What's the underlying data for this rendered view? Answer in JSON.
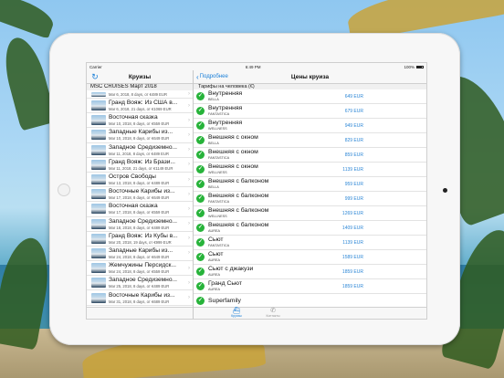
{
  "statusbar": {
    "carrier": "Carrier",
    "time": "6:49 PM",
    "battery": "100%"
  },
  "master": {
    "title": "Круизы",
    "section": "MSC CRUISES Март 2018",
    "cruises": [
      {
        "name": "",
        "meta": "Mar 6, 2018, 8 days, от €489 EUR"
      },
      {
        "name": "Гранд Вояж: Из США в...",
        "meta": "Mar 6, 2018, 21 days, от €1069 EUR"
      },
      {
        "name": "Восточная сказка",
        "meta": "Mar 10, 2018, 8 days, от €559 EUR"
      },
      {
        "name": "Западные Карибы из...",
        "meta": "Mar 10, 2018, 8 days, от €649 EUR"
      },
      {
        "name": "Западное Средиземно...",
        "meta": "Mar 11, 2018, 8 days, от €489 EUR"
      },
      {
        "name": "Гранд Вояж: Из Брази...",
        "meta": "Mar 11, 2018, 21 days, от €1149 EUR"
      },
      {
        "name": "Остров Свободы",
        "meta": "Mar 13, 2018, 8 days, от €489 EUR"
      },
      {
        "name": "Восточные Карибы из...",
        "meta": "Mar 17, 2018, 8 days, от €649 EUR"
      },
      {
        "name": "Восточная сказка",
        "meta": "Mar 17, 2018, 8 days, от €559 EUR"
      },
      {
        "name": "Западное Средиземно...",
        "meta": "Mar 18, 2018, 8 days, от €489 EUR"
      },
      {
        "name": "Гранд Вояж: Из Кубы в...",
        "meta": "Mar 20, 2018, 19 days, от €999 EUR"
      },
      {
        "name": "Западные Карибы из...",
        "meta": "Mar 24, 2018, 8 days, от €649 EUR"
      },
      {
        "name": "Жемчужины Персидск...",
        "meta": "Mar 24, 2018, 8 days, от €559 EUR"
      },
      {
        "name": "Западное Средиземно...",
        "meta": "Mar 25, 2018, 8 days, от €489 EUR"
      },
      {
        "name": "Восточные Карибы из...",
        "meta": "Mar 31, 2018, 8 days, от €689 EUR"
      }
    ]
  },
  "detail": {
    "back_label": "Подробнее",
    "title": "Цены круиза",
    "section": "Тарифы на человека (€)",
    "fares": [
      {
        "cabin": "Внутренняя",
        "ship": "BELLA",
        "price": "649 EUR"
      },
      {
        "cabin": "Внутренняя",
        "ship": "FANTASTICA",
        "price": "679 EUR"
      },
      {
        "cabin": "Внутренняя",
        "ship": "WELLNESS",
        "price": "949 EUR"
      },
      {
        "cabin": "Внешняя с окном",
        "ship": "BELLA",
        "price": "829 EUR"
      },
      {
        "cabin": "Внешняя с окном",
        "ship": "FANTASTICA",
        "price": "859 EUR"
      },
      {
        "cabin": "Внешняя с окном",
        "ship": "WELLNESS",
        "price": "1139 EUR"
      },
      {
        "cabin": "Внешняя с балконом",
        "ship": "BELLA",
        "price": "959 EUR"
      },
      {
        "cabin": "Внешняя с балконом",
        "ship": "FANTASTICA",
        "price": "999 EUR"
      },
      {
        "cabin": "Внешняя с балконом",
        "ship": "WELLNESS",
        "price": "1269 EUR"
      },
      {
        "cabin": "Внешняя с балконом",
        "ship": "AUREA",
        "price": "1409 EUR"
      },
      {
        "cabin": "Сьют",
        "ship": "FANTASTICA",
        "price": "1139 EUR"
      },
      {
        "cabin": "Сьют",
        "ship": "AUREA",
        "price": "1589 EUR"
      },
      {
        "cabin": "Сьют с джакузи",
        "ship": "AUREA",
        "price": "1859 EUR"
      },
      {
        "cabin": "Гранд Сьют",
        "ship": "AUREA",
        "price": "1859 EUR"
      },
      {
        "cabin": "Superfamily",
        "ship": "",
        "price": ""
      }
    ]
  },
  "tabs": [
    {
      "label": "Круизы",
      "icon": "ship-icon",
      "active": true
    },
    {
      "label": "Контакты",
      "icon": "phone-icon",
      "active": false
    }
  ],
  "colors": {
    "accent": "#1a7fd8",
    "check": "#27b33a",
    "price": "#2b86d6"
  }
}
